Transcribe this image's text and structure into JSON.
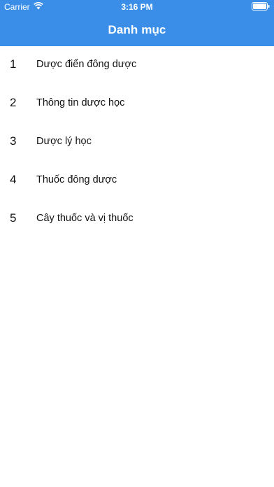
{
  "status_bar": {
    "carrier": "Carrier",
    "time": "3:16 PM",
    "wifi_icon": "wifi-icon",
    "battery_icon": "battery-icon"
  },
  "header": {
    "title": "Danh mục",
    "background_color": "#3b8ee8"
  },
  "list": {
    "items": [
      {
        "index": "1",
        "label": "Dược điển đông dược"
      },
      {
        "index": "2",
        "label": "Thông tin dược học"
      },
      {
        "index": "3",
        "label": "Dược lý học"
      },
      {
        "index": "4",
        "label": "Thuốc đông dược"
      },
      {
        "index": "5",
        "label": "Cây thuốc và vị thuốc"
      }
    ]
  }
}
